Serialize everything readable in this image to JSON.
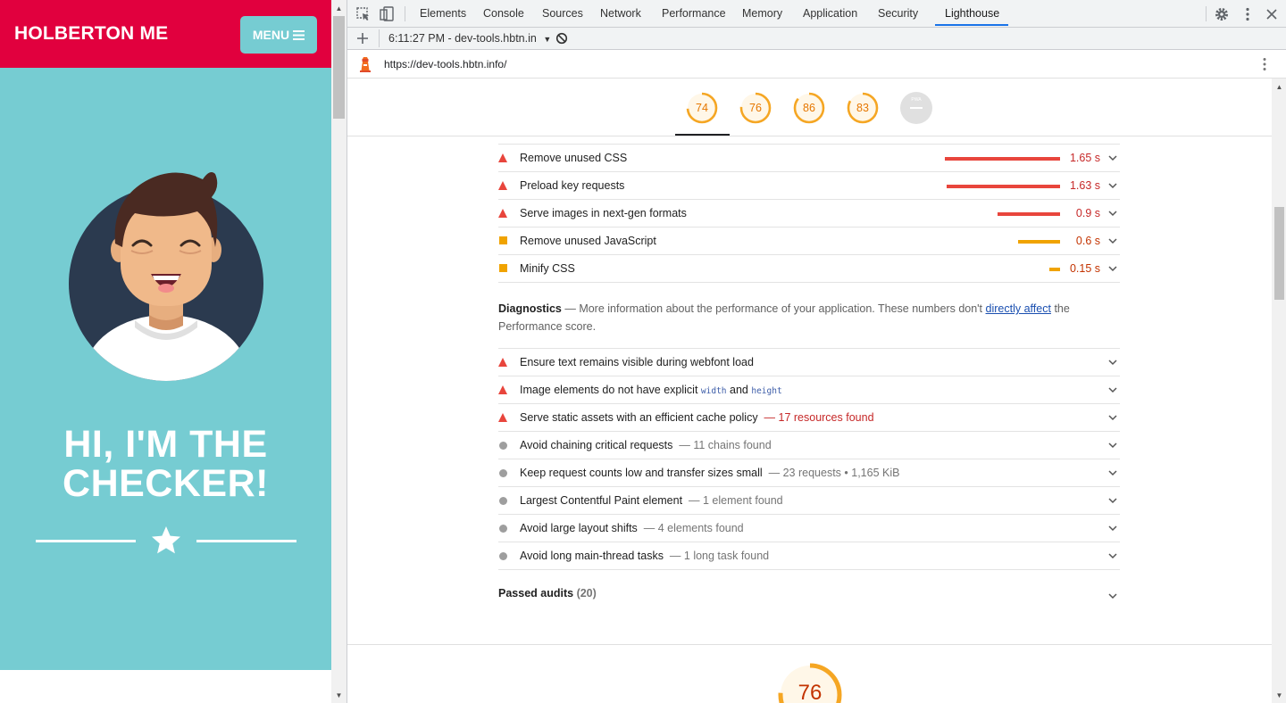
{
  "page": {
    "brand": "HOLBERTON ME",
    "menu_label": "MENU",
    "headline_line1": "HI, I'M THE",
    "headline_line2": "CHECKER!",
    "colors": {
      "topbar": "#e1003e",
      "hero": "#76ccd2"
    }
  },
  "devtools": {
    "tabs": [
      "Elements",
      "Console",
      "Sources",
      "Network",
      "Performance",
      "Memory",
      "Application",
      "Security",
      "Lighthouse"
    ],
    "active_tab": "Lighthouse",
    "report_selector": "6:11:27 PM - dev-tools.hbtn.in",
    "url": "https://dev-tools.hbtn.info/",
    "scores": [
      {
        "value": "74",
        "fraction": 0.74
      },
      {
        "value": "76",
        "fraction": 0.76
      },
      {
        "value": "86",
        "fraction": 0.86
      },
      {
        "value": "83",
        "fraction": 0.83
      },
      {
        "value": "PWA",
        "fraction": 0
      }
    ],
    "opportunities": [
      {
        "title": "Remove unused CSS",
        "value": "1.65 s",
        "severity": "fail"
      },
      {
        "title": "Preload key requests",
        "value": "1.63 s",
        "severity": "fail"
      },
      {
        "title": "Serve images in next-gen formats",
        "value": "0.9 s",
        "severity": "fail"
      },
      {
        "title": "Remove unused JavaScript",
        "value": "0.6 s",
        "severity": "average"
      },
      {
        "title": "Minify CSS",
        "value": "0.15 s",
        "severity": "average"
      }
    ],
    "diagnostics": {
      "heading": "Diagnostics",
      "description_pre": "— More information about the performance of your application. These numbers don't",
      "link": "directly affect",
      "description_post": "the Performance score."
    },
    "diagnostic_items": [
      {
        "title": "Ensure text remains visible during webfont load",
        "detail": "",
        "severity": "fail"
      },
      {
        "title": "Image elements do not have explicit",
        "code1": "width",
        "and": "and",
        "code2": "height",
        "detail": "",
        "severity": "fail"
      },
      {
        "title": "Serve static assets with an efficient cache policy",
        "detail": "— 17 resources found",
        "severity": "fail"
      },
      {
        "title": "Avoid chaining critical requests",
        "detail": "— 11 chains found",
        "severity": "info"
      },
      {
        "title": "Keep request counts low and transfer sizes small",
        "detail": "— 23 requests • 1,165 KiB",
        "severity": "info"
      },
      {
        "title": "Largest Contentful Paint element",
        "detail": "— 1 element found",
        "severity": "info"
      },
      {
        "title": "Avoid large layout shifts",
        "detail": "— 4 elements found",
        "severity": "info"
      },
      {
        "title": "Avoid long main-thread tasks",
        "detail": "— 1 long task found",
        "severity": "info"
      }
    ],
    "passed_audits": {
      "label": "Passed audits",
      "count": "(20)"
    },
    "bottom_score": "76"
  }
}
